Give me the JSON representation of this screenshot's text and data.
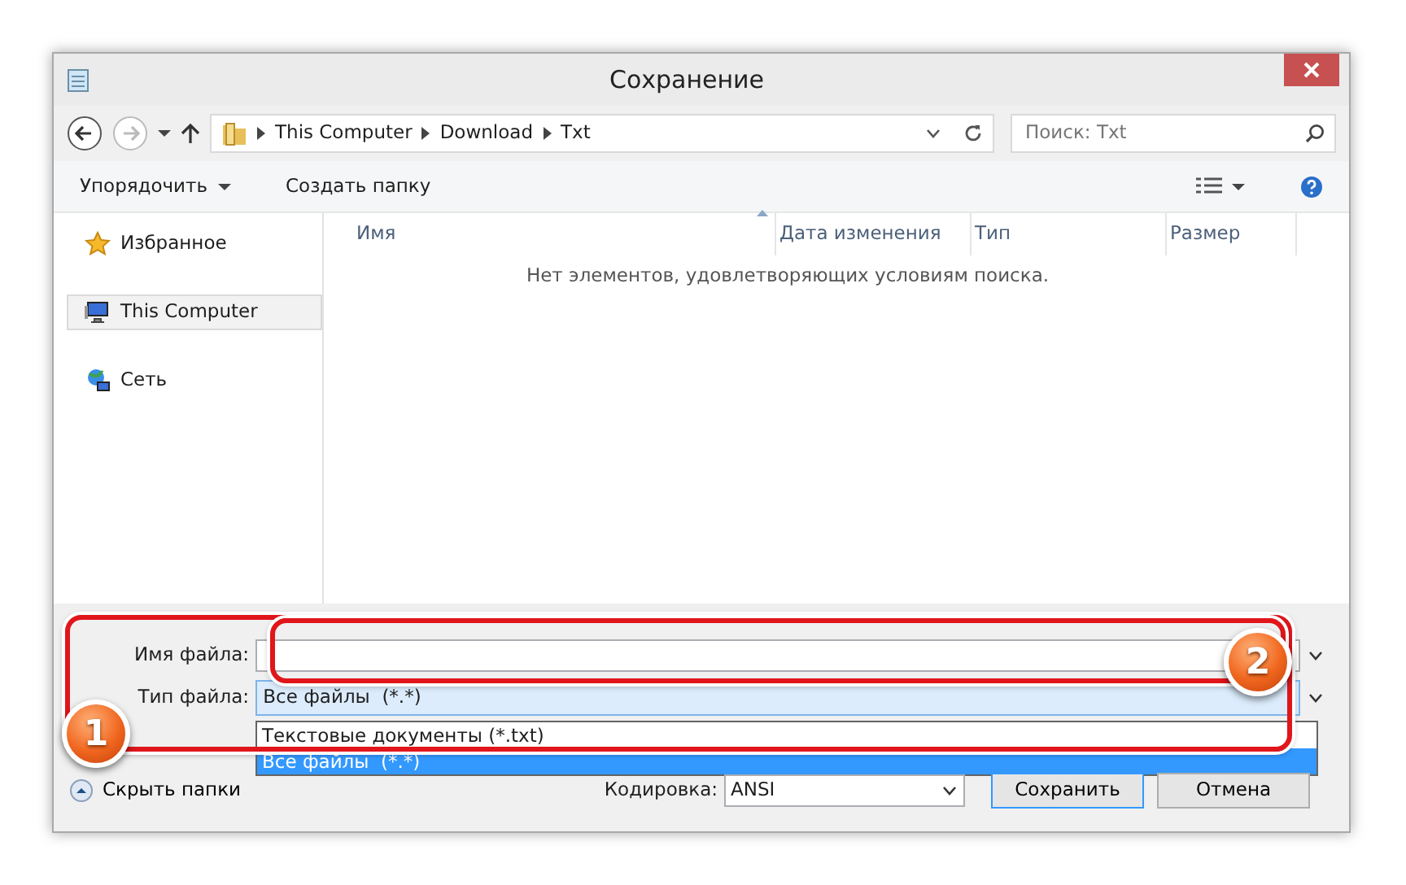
{
  "window": {
    "title": "Сохранение"
  },
  "navigation": {
    "path": [
      "This Computer",
      "Download",
      "Txt"
    ],
    "search": {
      "placeholder": "Поиск: Txt"
    }
  },
  "toolbar": {
    "organize": "Упорядочить",
    "new_folder": "Создать папку"
  },
  "sidebar": {
    "items": [
      {
        "label": "Избранное",
        "kind": "favorites",
        "selected": false
      },
      {
        "label": "This Computer",
        "kind": "computer",
        "selected": true
      },
      {
        "label": "Сеть",
        "kind": "network",
        "selected": false
      }
    ]
  },
  "file_list": {
    "columns": [
      {
        "label": "Имя",
        "sorted": true
      },
      {
        "label": "Дата изменения",
        "sorted": false
      },
      {
        "label": "Тип",
        "sorted": false
      },
      {
        "label": "Размер",
        "sorted": false
      }
    ],
    "empty_message": "Нет элементов, удовлетворяющих условиям поиска."
  },
  "form": {
    "file_name": {
      "label": "Имя файла:"
    },
    "file_type": {
      "label": "Тип файла:",
      "value": "Все файлы  (*.*)",
      "expanded": true,
      "options": [
        {
          "label": "Текстовые документы (*.txt)",
          "selected": false
        },
        {
          "label": "Все файлы  (*.*)",
          "selected": true
        }
      ]
    },
    "hide_folders": "Скрыть папки",
    "encoding": {
      "label": "Кодировка:",
      "value": "ANSI"
    },
    "buttons": [
      "Сохранить",
      "Отмена"
    ]
  },
  "annotations": [
    {
      "label": "1"
    },
    {
      "label": "2"
    }
  ]
}
